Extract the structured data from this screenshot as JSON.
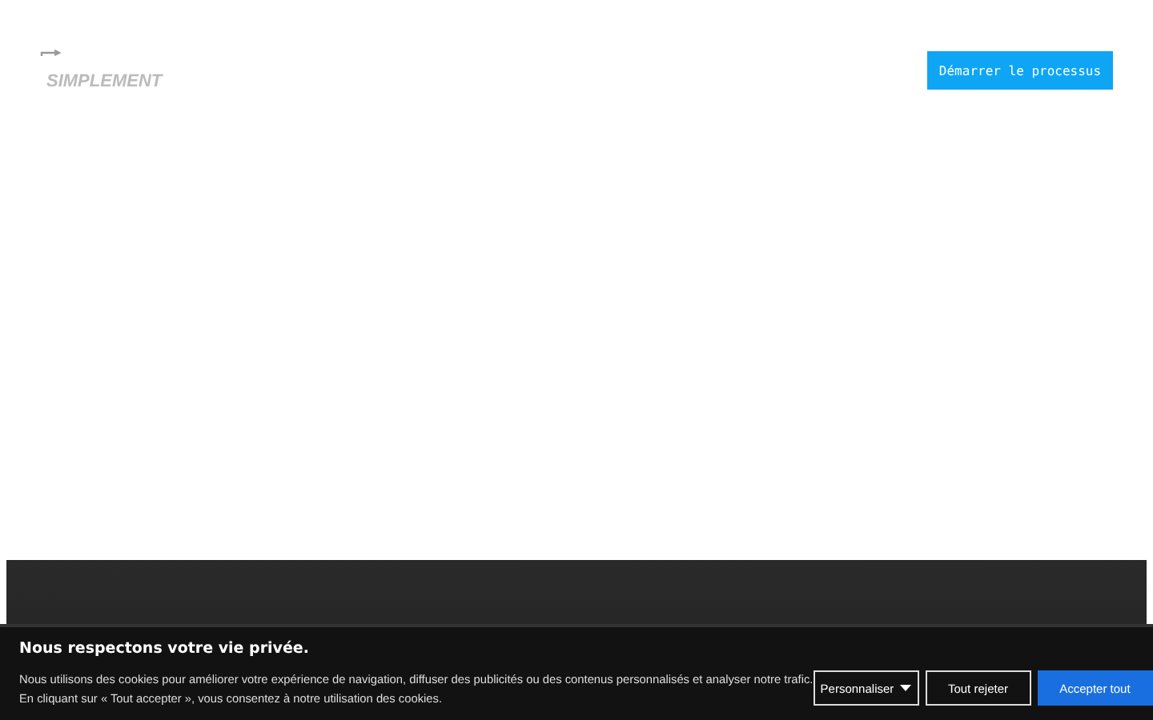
{
  "header": {
    "logo": "SIMPLEMENT",
    "cta": "Démarrer le processus"
  },
  "cookie_banner": {
    "title": "Nous respectons votre vie privée.",
    "lines": [
      "Nous utilisons des cookies pour améliorer votre expérience de navigation, diffuser des publicités ou des contenus personnalisés et analyser notre trafic.",
      "En cliquant sur « Tout accepter », vous consentez à notre utilisation des cookies."
    ],
    "buttons": [
      {
        "label": "Personnaliser",
        "kind": "dropdown"
      },
      {
        "label": "Tout rejeter",
        "kind": "outline"
      },
      {
        "label": "Accepter tout",
        "kind": "primary"
      }
    ]
  }
}
